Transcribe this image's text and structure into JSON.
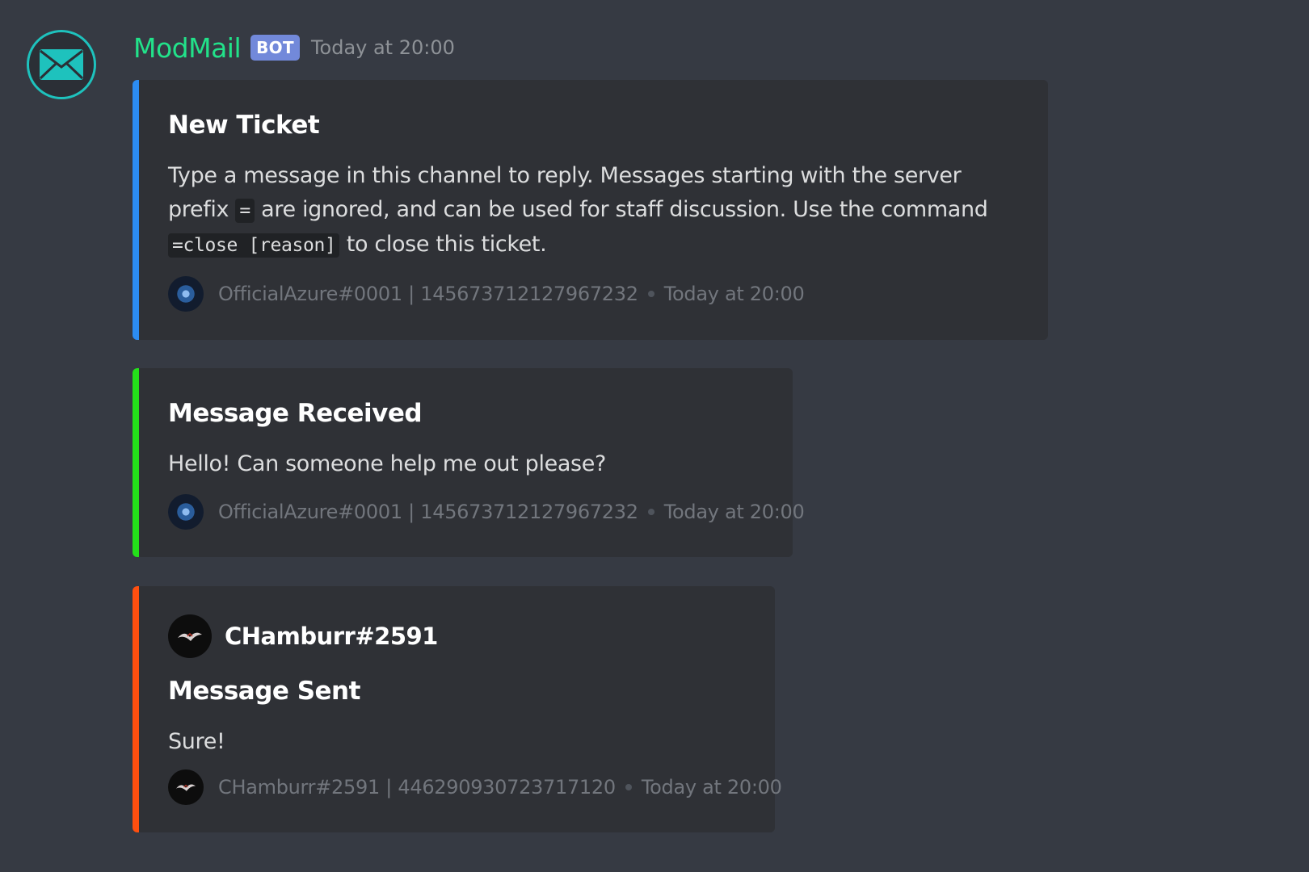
{
  "message": {
    "username": "ModMail",
    "badge": "BOT",
    "timestamp": "Today at 20:00",
    "avatar_icon": "envelope-icon"
  },
  "embeds": [
    {
      "color": "#2c8cf2",
      "title": "New Ticket",
      "description_parts": {
        "text1": "Type a message in this channel to reply. Messages starting with the server prefix",
        "code1": "=",
        "text2": "are ignored, and can be used for staff discussion. Use the command",
        "code2": "=close [reason]",
        "text3": "to close this ticket."
      },
      "footer": {
        "text": "OfficialAzure#0001 | 145673712127967232",
        "timestamp": "Today at 20:00"
      }
    },
    {
      "color": "#24e01a",
      "title": "Message Received",
      "description": "Hello! Can someone help me out please?",
      "footer": {
        "text": "OfficialAzure#0001 | 145673712127967232",
        "timestamp": "Today at 20:00"
      }
    },
    {
      "color": "#ff4f0f",
      "author": "CHamburr#2591",
      "title": "Message Sent",
      "description": "Sure!",
      "footer": {
        "text": "CHamburr#2591 | 446290930723717120",
        "timestamp": "Today at 20:00"
      }
    }
  ]
}
